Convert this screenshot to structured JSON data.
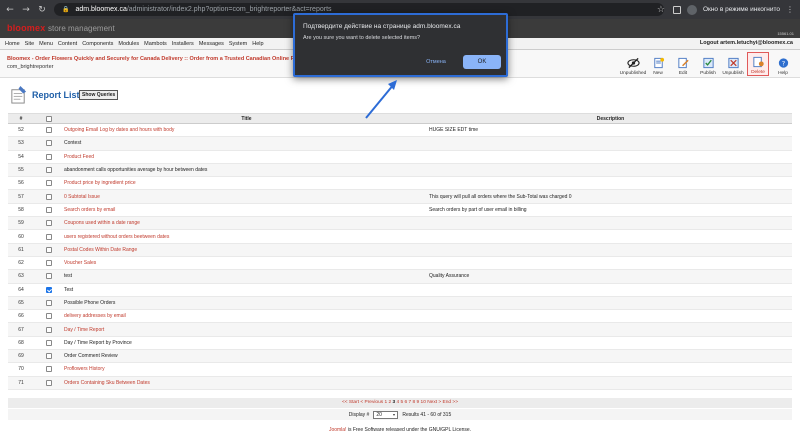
{
  "browser": {
    "url_host": "adm.bloomex.ca",
    "url_path": "/administrator/index2.php?option=com_brightreporter&act=reports",
    "incognito_label": "Окно в режиме инкогнито"
  },
  "site": {
    "brand": "bloomex",
    "brand_sub": "store management",
    "version": "15561.01"
  },
  "menu": {
    "items": [
      "Home",
      "Site",
      "Menu",
      "Content",
      "Components",
      "Modules",
      "Mambots",
      "Installers",
      "Messages",
      "System",
      "Help"
    ],
    "logout": "Logout artem.letuchyi@bloomex.ca"
  },
  "breadcrumb": {
    "site_title": "Bloomex - Order Flowers Quickly and Securely for Canada Delivery :: Order from a Trusted Canadian Online Florist",
    "module": "com_brightreporter"
  },
  "toolbar": {
    "buttons": [
      {
        "label": "Unpublished",
        "icon": "eye-slash-icon"
      },
      {
        "label": "New",
        "icon": "new-icon"
      },
      {
        "label": "Edit",
        "icon": "edit-icon"
      },
      {
        "label": "Publish",
        "icon": "publish-icon"
      },
      {
        "label": "Unpublish",
        "icon": "unpublish-icon"
      },
      {
        "label": "Delete",
        "icon": "delete-icon"
      },
      {
        "label": "Help",
        "icon": "help-icon"
      }
    ]
  },
  "page": {
    "title": "Report List",
    "show_queries": "Show Queries"
  },
  "table": {
    "headers": {
      "num": "#",
      "title": "Title",
      "description": "Description"
    },
    "rows": [
      {
        "num": "52",
        "title": "Outgoing Email Log by dates and hours with body",
        "desc": "HUGE SIZE EDT time",
        "link": true,
        "checked": false
      },
      {
        "num": "53",
        "title": "Contest",
        "desc": "",
        "link": false,
        "checked": false
      },
      {
        "num": "54",
        "title": "Product Feed",
        "desc": "",
        "link": true,
        "checked": false
      },
      {
        "num": "55",
        "title": "abandonment calls opportunities average by hour between dates",
        "desc": "",
        "link": false,
        "checked": false
      },
      {
        "num": "56",
        "title": "Product price by ingredient price",
        "desc": "",
        "link": true,
        "checked": false
      },
      {
        "num": "57",
        "title": "0 Subtotal Issue",
        "desc": "This query will pull all orders where the Sub-Total was charged 0",
        "link": true,
        "checked": false
      },
      {
        "num": "58",
        "title": "Search orders by email",
        "desc": "Search orders by part of user email in billing",
        "link": true,
        "checked": false
      },
      {
        "num": "59",
        "title": "Coupons used within a date range",
        "desc": "",
        "link": true,
        "checked": false
      },
      {
        "num": "60",
        "title": "users registered without orders beetween dates",
        "desc": "",
        "link": true,
        "checked": false
      },
      {
        "num": "61",
        "title": "Postal Codes Within Date Range",
        "desc": "",
        "link": true,
        "checked": false
      },
      {
        "num": "62",
        "title": "Voucher Sales",
        "desc": "",
        "link": true,
        "checked": false
      },
      {
        "num": "63",
        "title": "test",
        "desc": "Quality Assurance",
        "link": false,
        "checked": false
      },
      {
        "num": "64",
        "title": "Test",
        "desc": "",
        "link": false,
        "checked": true
      },
      {
        "num": "65",
        "title": "Possible Phone Orders",
        "desc": "",
        "link": false,
        "checked": false
      },
      {
        "num": "66",
        "title": "delivery addresses by email",
        "desc": "",
        "link": true,
        "checked": false
      },
      {
        "num": "67",
        "title": "Day / Time Report",
        "desc": "",
        "link": true,
        "checked": false
      },
      {
        "num": "68",
        "title": "Day / Time Report by Province",
        "desc": "",
        "link": false,
        "checked": false
      },
      {
        "num": "69",
        "title": "Order Comment Review",
        "desc": "",
        "link": false,
        "checked": false
      },
      {
        "num": "70",
        "title": "Proflowers History",
        "desc": "",
        "link": true,
        "checked": false
      },
      {
        "num": "71",
        "title": "Orders Containing Sku Between Dates",
        "desc": "",
        "link": true,
        "checked": false
      }
    ]
  },
  "pager": {
    "prefix": "<< Start < Previous 1 2",
    "current": "3",
    "suffix": "4 5 6 7 8 9 10 Next > End >>",
    "display_label": "Display #",
    "display_value": "20",
    "results": "Results 41 - 60 of 315"
  },
  "footer": {
    "joomla": "Joomla!",
    "text": " is Free Software released under the GNU/GPL License."
  },
  "dialog": {
    "title": "Подтвердите действие на странице adm.bloomex.ca",
    "message": "Are you sure you want to delete selected items?",
    "cancel": "Отмена",
    "ok": "OK"
  },
  "colors": {
    "accent_link": "#c0392b",
    "dialog_border": "#2d6cd6",
    "ok_button": "#8ab4f8"
  }
}
